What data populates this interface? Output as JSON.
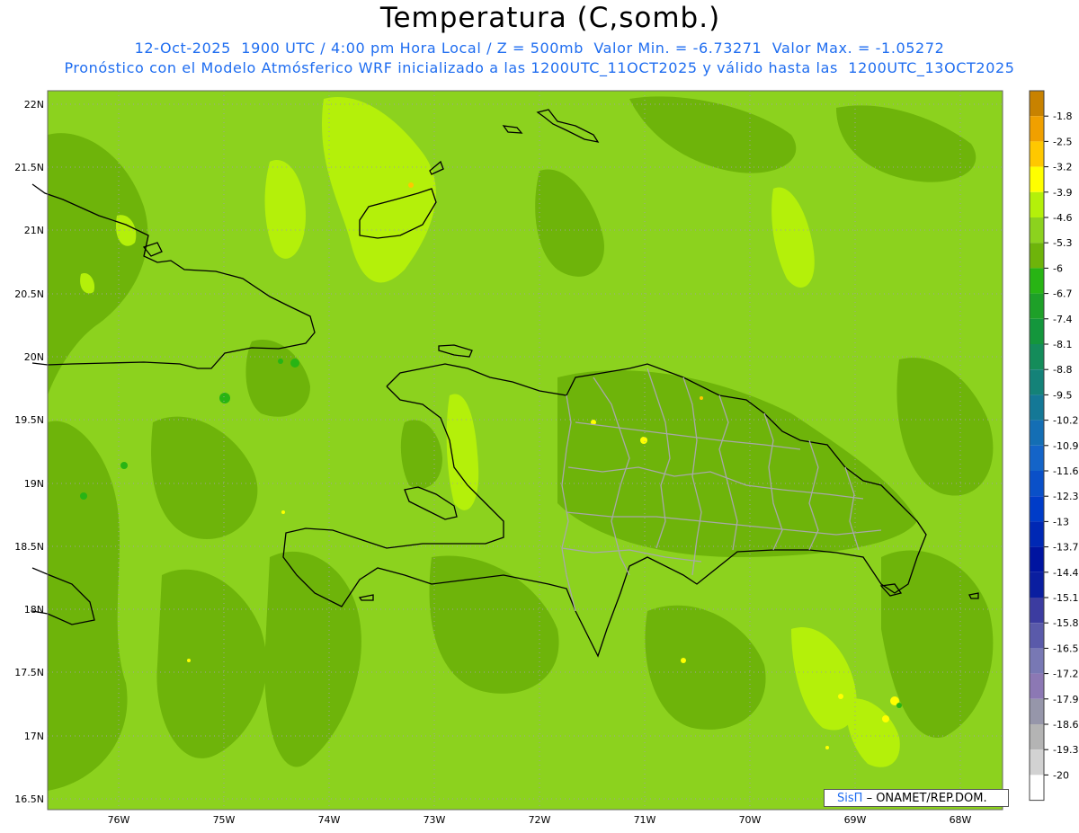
{
  "title": "Temperatura (C,somb.)",
  "subtitle_line1": "12-Oct-2025  1900 UTC / 4:00 pm Hora Local / Z = 500mb  Valor Min. = -6.73271  Valor Max. = -1.05272",
  "subtitle_line2": "Pronóstico con el Modelo Atmósferico WRF inicializado a las 1200UTC_11OCT2025 y válido hasta las  1200UTC_13OCT2025",
  "credit": {
    "brand": "SisΠ",
    "text": "– ONAMET/REP.DOM."
  },
  "y_ticks": [
    "22N",
    "21.5N",
    "21N",
    "20.5N",
    "20N",
    "19.5N",
    "19N",
    "18.5N",
    "18N",
    "17.5N",
    "17N",
    "16.5N"
  ],
  "x_ticks": [
    "76W",
    "75W",
    "74W",
    "73W",
    "72W",
    "71W",
    "70W",
    "69W",
    "68W"
  ],
  "colorbar": [
    {
      "label": "-1.8",
      "color": "#c88200"
    },
    {
      "label": "-2.5",
      "color": "#f0a000"
    },
    {
      "label": "-3.2",
      "color": "#ffc800"
    },
    {
      "label": "-3.9",
      "color": "#ffff00"
    },
    {
      "label": "-4.6",
      "color": "#b4f00a"
    },
    {
      "label": "-5.3",
      "color": "#8cd21e"
    },
    {
      "label": "-6",
      "color": "#6eb40a"
    },
    {
      "label": "-6.7",
      "color": "#28b414"
    },
    {
      "label": "-7.4",
      "color": "#1ea028"
    },
    {
      "label": "-8.1",
      "color": "#14963c"
    },
    {
      "label": "-8.8",
      "color": "#148c5a"
    },
    {
      "label": "-9.5",
      "color": "#148278"
    },
    {
      "label": "-10.2",
      "color": "#147896"
    },
    {
      "label": "-10.9",
      "color": "#146eb4"
    },
    {
      "label": "-11.6",
      "color": "#1464c8"
    },
    {
      "label": "-12.3",
      "color": "#0a50c8"
    },
    {
      "label": "-13",
      "color": "#003cc8"
    },
    {
      "label": "-13.7",
      "color": "#0028b4"
    },
    {
      "label": "-14.4",
      "color": "#0014a0"
    },
    {
      "label": "-15.1",
      "color": "#0a1ea0"
    },
    {
      "label": "-15.8",
      "color": "#3c3ca0"
    },
    {
      "label": "-16.5",
      "color": "#5a5aaa"
    },
    {
      "label": "-17.2",
      "color": "#7878b4"
    },
    {
      "label": "-17.9",
      "color": "#8c78b4"
    },
    {
      "label": "-18.6",
      "color": "#9696aa"
    },
    {
      "label": "-19.3",
      "color": "#b4b4b4"
    },
    {
      "label": "-20",
      "color": "#d2d2d2"
    },
    {
      "label": "",
      "color": "#ffffff"
    }
  ],
  "field_colors": {
    "base": "#8cd21e",
    "dark": "#6eb40a",
    "light": "#b4f00a",
    "yellow": "#ffff00",
    "green": "#28b414"
  }
}
